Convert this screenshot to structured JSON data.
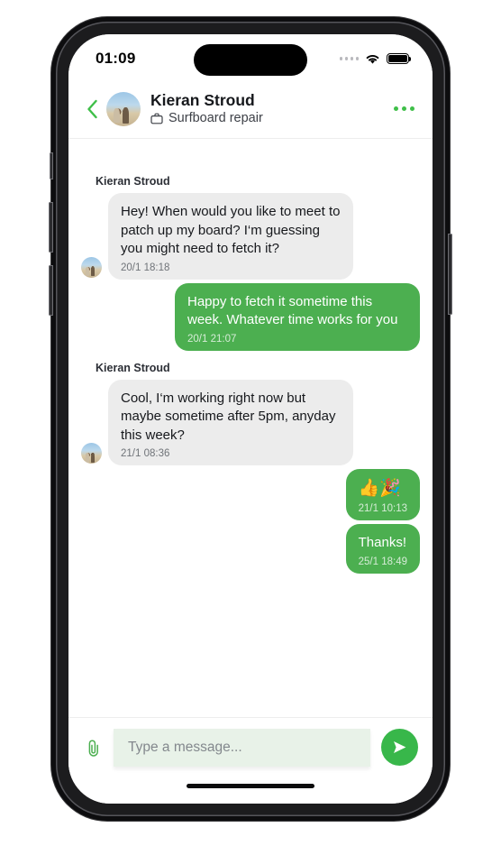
{
  "status_bar": {
    "time": "01:09",
    "signal_icon": "signal-dots-icon",
    "wifi_icon": "wifi-icon",
    "battery_icon": "battery-full-icon",
    "battery_level": 100
  },
  "header": {
    "back_icon": "chevron-left-icon",
    "avatar": "contact-avatar",
    "name": "Kieran Stroud",
    "subtitle": "Surfboard repair",
    "subtitle_icon": "briefcase-icon",
    "menu_icon": "more-options-icon"
  },
  "conversation": {
    "messages": [
      {
        "direction": "incoming",
        "sender": "Kieran Stroud",
        "show_sender": true,
        "text": "Hey! When would you like to meet to patch up my board? I‘m guessing you might need to fetch it?",
        "time": "20/1 18:18",
        "is_emoji": false
      },
      {
        "direction": "outgoing",
        "sender": "",
        "show_sender": false,
        "text": "Happy to fetch it sometime this week. Whatever time works for you",
        "time": "20/1 21:07",
        "is_emoji": false
      },
      {
        "direction": "incoming",
        "sender": "Kieran Stroud",
        "show_sender": true,
        "text": "Cool, I‘m working right now but maybe sometime after 5pm, anyday this week?",
        "time": "21/1 08:36",
        "is_emoji": false
      },
      {
        "direction": "outgoing",
        "sender": "",
        "show_sender": false,
        "text": "👍🎉",
        "time": "21/1 10:13",
        "is_emoji": true
      },
      {
        "direction": "outgoing",
        "sender": "",
        "show_sender": false,
        "text": "Thanks!",
        "time": "25/1 18:49",
        "is_emoji": false
      }
    ]
  },
  "composer": {
    "attach_icon": "paperclip-icon",
    "input_value": "",
    "input_placeholder": "Type a message...",
    "send_icon": "send-icon"
  },
  "colors": {
    "accent_green": "#4caf50",
    "send_green": "#38b74a",
    "incoming_bubble": "#ececec",
    "input_background": "#e8f2e8"
  }
}
